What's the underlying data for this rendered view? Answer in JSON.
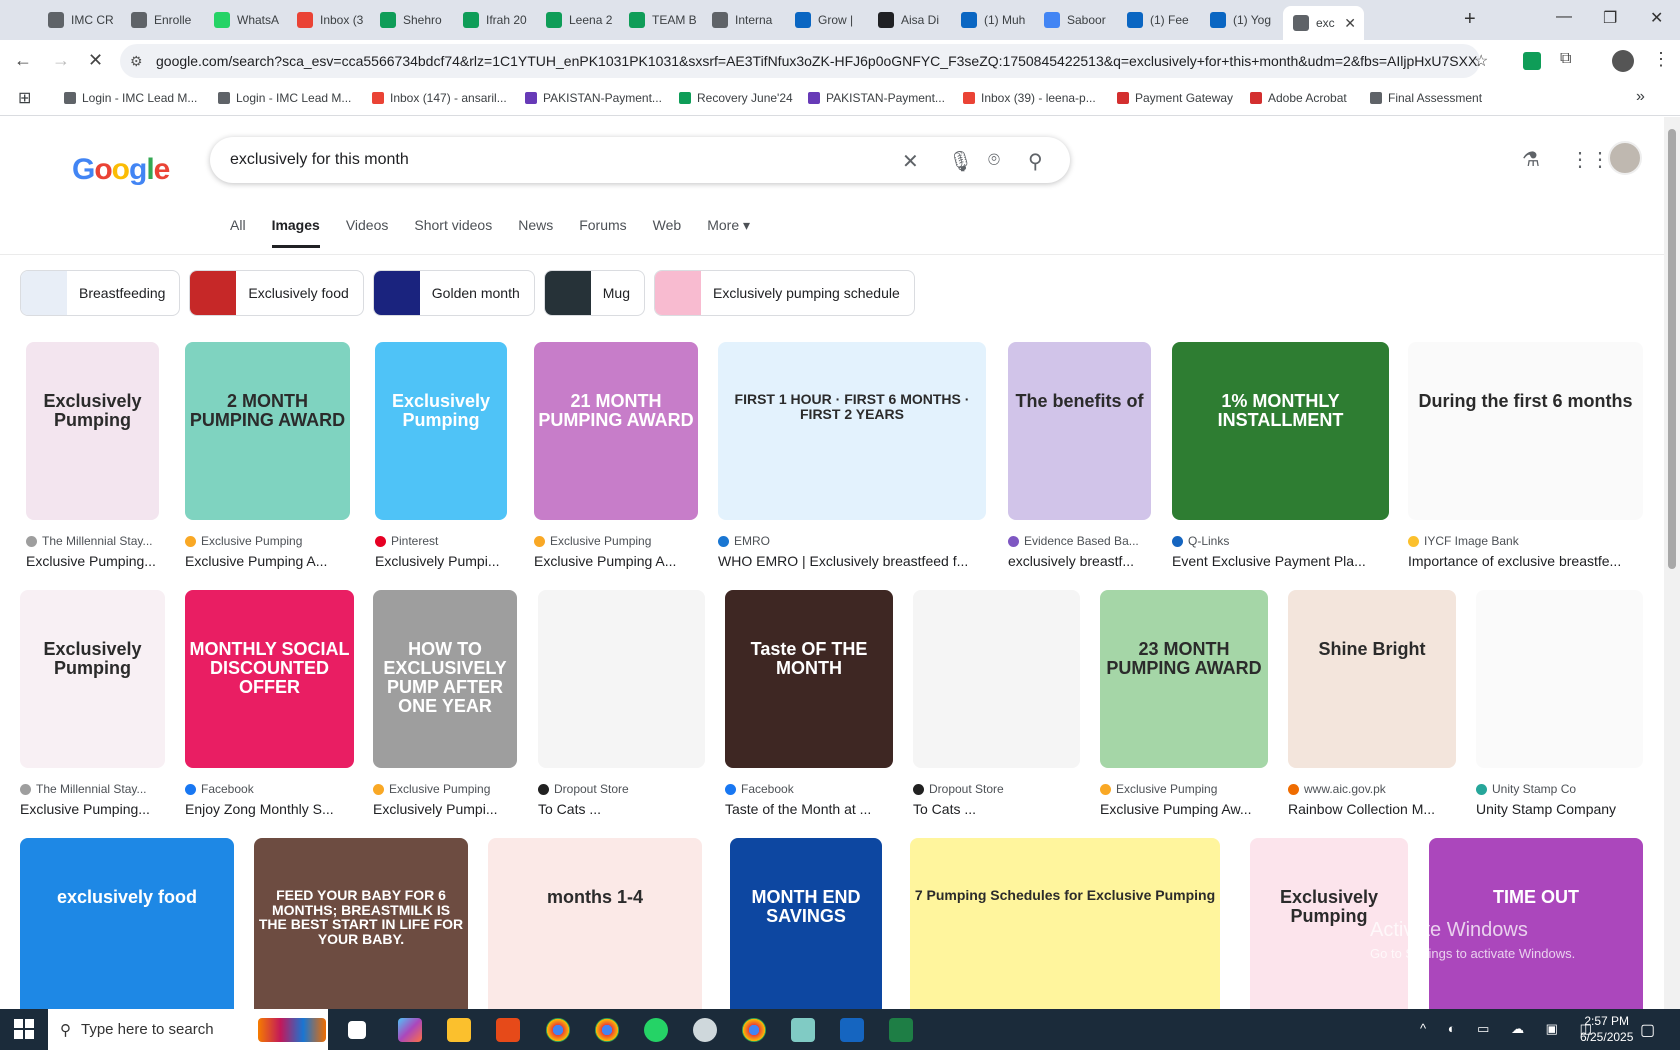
{
  "browser": {
    "tabs": [
      {
        "label": "IMC CR",
        "color": "#5f6368"
      },
      {
        "label": "Enrolle",
        "color": "#5f6368"
      },
      {
        "label": "WhatsA",
        "color": "#25d366"
      },
      {
        "label": "Inbox (3",
        "color": "#ea4335"
      },
      {
        "label": "Shehro",
        "color": "#0f9d58"
      },
      {
        "label": "Ifrah 20",
        "color": "#0f9d58"
      },
      {
        "label": "Leena 2",
        "color": "#0f9d58"
      },
      {
        "label": "TEAM B",
        "color": "#0f9d58"
      },
      {
        "label": "Interna",
        "color": "#5f6368"
      },
      {
        "label": "Grow |",
        "color": "#0a66c2"
      },
      {
        "label": "Aisa Di",
        "color": "#202124"
      },
      {
        "label": "(1) Muh",
        "color": "#0a66c2"
      },
      {
        "label": "Saboor",
        "color": "#4285f4"
      },
      {
        "label": "(1) Fee",
        "color": "#0a66c2"
      },
      {
        "label": "(1) Yog",
        "color": "#0a66c2"
      },
      {
        "label": "exc",
        "color": "#5f6368"
      }
    ],
    "url": "google.com/search?sca_esv=cca5566734bdcf74&rlz=1C1YTUH_enPK1031PK1031&sxsrf=AE3TifNfux3oZK-HFJ6p0oGNFYC_F3seZQ:1750845422513&q=exclusively+for+this+month&udm=2&fbs=AIljpHxU7SXX...",
    "bookmarks": [
      {
        "label": "Login - IMC Lead M...",
        "color": "#5f6368"
      },
      {
        "label": "Login - IMC Lead M...",
        "color": "#5f6368"
      },
      {
        "label": "Inbox (147) - ansaril...",
        "color": "#ea4335"
      },
      {
        "label": "PAKISTAN-Payment...",
        "color": "#673ab7"
      },
      {
        "label": "Recovery June'24",
        "color": "#0f9d58"
      },
      {
        "label": "PAKISTAN-Payment...",
        "color": "#673ab7"
      },
      {
        "label": "Inbox (39) - leena-p...",
        "color": "#ea4335"
      },
      {
        "label": "Payment Gateway",
        "color": "#d32f2f"
      },
      {
        "label": "Adobe Acrobat",
        "color": "#d32f2f"
      },
      {
        "label": "Final Assessment",
        "color": "#5f6368"
      }
    ]
  },
  "google": {
    "logo": "Google",
    "query": "exclusively for this month",
    "tabs": [
      "All",
      "Images",
      "Videos",
      "Short videos",
      "News",
      "Forums",
      "Web",
      "More ▾"
    ],
    "chips": [
      {
        "label": "Breastfeeding",
        "color": "#e8eef7"
      },
      {
        "label": "Exclusively food",
        "color": "#c62828"
      },
      {
        "label": "Golden month",
        "color": "#1a237e"
      },
      {
        "label": "Mug",
        "color": "#263238"
      },
      {
        "label": "Exclusively pumping schedule",
        "color": "#f8bbd0"
      }
    ],
    "row1": [
      {
        "source": "The Millennial Stay...",
        "title": "Exclusive Pumping...",
        "color": "#f3e5ef",
        "fav": "#9e9e9e",
        "text": "Exclusively Pumping"
      },
      {
        "source": "Exclusive Pumping",
        "title": "Exclusive Pumping A...",
        "color": "#7fd3c0",
        "fav": "#f9a825",
        "text": "2 MONTH PUMPING AWARD"
      },
      {
        "source": "Pinterest",
        "title": "Exclusively Pumpi...",
        "color": "#4fc3f7",
        "fav": "#e60023",
        "text": "Exclusively Pumping"
      },
      {
        "source": "Exclusive Pumping",
        "title": "Exclusive Pumping A...",
        "color": "#c77dc9",
        "fav": "#f9a825",
        "text": "21 MONTH PUMPING AWARD"
      },
      {
        "source": "EMRO",
        "title": "WHO EMRO | Exclusively breastfeed f...",
        "color": "#e3f2fd",
        "fav": "#1976d2",
        "text": "FIRST 1 HOUR · FIRST 6 MONTHS · FIRST 2 YEARS"
      },
      {
        "source": "Evidence Based Ba...",
        "title": "exclusively breastf...",
        "color": "#d1c4e9",
        "fav": "#7e57c2",
        "text": "The benefits of"
      },
      {
        "source": "Q-Links",
        "title": "Event Exclusive Payment Pla...",
        "color": "#2e7d32",
        "fav": "#1565c0",
        "text": "1% MONTHLY INSTALLMENT"
      },
      {
        "source": "IYCF Image Bank",
        "title": "Importance of exclusive breastfe...",
        "color": "#fafafa",
        "fav": "#fbc02d",
        "text": "During the first 6 months"
      }
    ],
    "row2": [
      {
        "source": "The Millennial Stay...",
        "title": "Exclusive Pumping...",
        "color": "#f8f0f4",
        "fav": "#9e9e9e",
        "text": "Exclusively Pumping"
      },
      {
        "source": "Facebook",
        "title": "Enjoy Zong Monthly S...",
        "color": "#e91e63",
        "fav": "#1877f2",
        "text": "MONTHLY SOCIAL DISCOUNTED OFFER"
      },
      {
        "source": "Exclusive Pumping",
        "title": "Exclusively Pumpi...",
        "color": "#9e9e9e",
        "fav": "#f9a825",
        "text": "HOW TO EXCLUSIVELY PUMP AFTER ONE YEAR"
      },
      {
        "source": "Dropout Store",
        "title": "To Cats ...",
        "color": "#f5f5f5",
        "fav": "#212121",
        "text": ""
      },
      {
        "source": "Facebook",
        "title": "Taste of the Month at ...",
        "color": "#3e2723",
        "fav": "#1877f2",
        "text": "Taste OF THE MONTH"
      },
      {
        "source": "Dropout Store",
        "title": "To Cats ...",
        "color": "#f5f5f5",
        "fav": "#212121",
        "text": ""
      },
      {
        "source": "Exclusive Pumping",
        "title": "Exclusive Pumping Aw...",
        "color": "#a5d6a7",
        "fav": "#f9a825",
        "text": "23 MONTH PUMPING AWARD"
      },
      {
        "source": "www.aic.gov.pk",
        "title": "Rainbow Collection M...",
        "color": "#f3e5dc",
        "fav": "#ef6c00",
        "text": "Shine Bright"
      },
      {
        "source": "Unity Stamp Co",
        "title": "Unity Stamp Company",
        "color": "#fafafa",
        "fav": "#26a69a",
        "text": ""
      }
    ],
    "row3": [
      {
        "color": "#1e88e5",
        "text": "exclusively food"
      },
      {
        "color": "#6d4c41",
        "text": "FEED YOUR BABY FOR 6 MONTHS; BREASTMILK IS THE BEST START IN LIFE FOR YOUR BABY."
      },
      {
        "color": "#fbe9e7",
        "text": "months 1-4"
      },
      {
        "color": "#0d47a1",
        "text": "MONTH END SAVINGS"
      },
      {
        "color": "#fff59d",
        "text": "7 Pumping Schedules for Exclusive Pumping"
      },
      {
        "color": "#fce4ec",
        "text": "Exclusively Pumping"
      },
      {
        "color": "#ab47bc",
        "text": "TIME OUT"
      }
    ]
  },
  "windows": {
    "watermark_title": "Activate Windows",
    "watermark_sub": "Go to Settings to activate Windows.",
    "taskbar_search": "Type here to search",
    "time": "2:57 PM",
    "date": "6/25/2025"
  }
}
